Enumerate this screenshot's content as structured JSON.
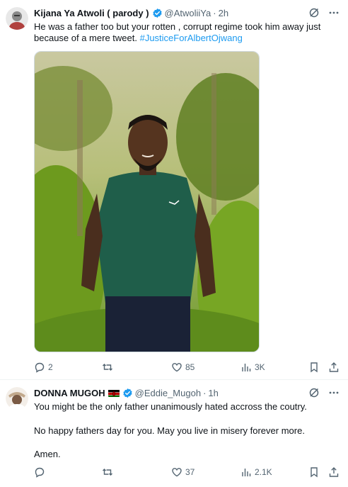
{
  "tweets": [
    {
      "author_name": "Kijana Ya Atwoli ( parody )",
      "handle": "@AtwoliiYa",
      "separator": "·",
      "time": "2h",
      "text_main": "He was a father too but your rotten , corrupt regime took him away just because of a mere tweet. ",
      "hashtag": "#JusticeForAlbertOjwang",
      "replies": "2",
      "reposts": "",
      "likes": "85",
      "views": "3K"
    },
    {
      "author_name": "DONNA MUGOH",
      "handle": "@Eddie_Mugoh",
      "separator": "·",
      "time": "1h",
      "lines": [
        "You might be the only father unanimously hated accross the coutry.",
        "No happy fathers day for you. May you live in misery forever more.",
        "Amen."
      ],
      "replies": "",
      "reposts": "",
      "likes": "37",
      "views": "2.1K"
    }
  ],
  "colors": {
    "accent": "#1d9bf0",
    "secondary_text": "#536471",
    "primary_text": "#0f1419"
  },
  "icons": [
    "verified-badge-icon",
    "grok-icon",
    "more-icon",
    "reply-icon",
    "repost-icon",
    "like-icon",
    "views-icon",
    "bookmark-icon",
    "share-icon",
    "kenya-flag-icon"
  ]
}
